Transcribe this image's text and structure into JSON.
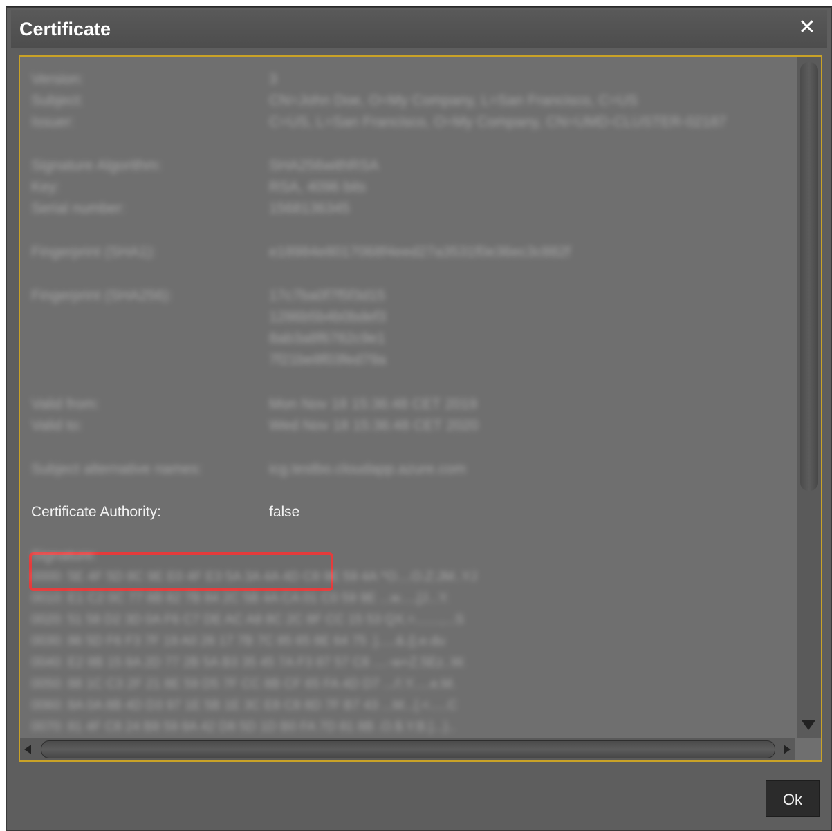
{
  "dialog": {
    "title": "Certificate",
    "close_icon": "close-icon",
    "ok_label": "Ok"
  },
  "certificate": {
    "rows": [
      {
        "label": "Version:",
        "value": "3"
      },
      {
        "label": "Subject:",
        "value": "CN=John Doe, O=My Company, L=San Francisco, C=US"
      },
      {
        "label": "Issuer:",
        "value": "C=US, L=San Francisco, O=My Company, CN=UMD-CLUSTER-02187"
      },
      {
        "label": "Signature Algorithm:",
        "value": "SHA256withRSA"
      },
      {
        "label": "Key:",
        "value": "RSA, 4096 bits"
      },
      {
        "label": "Serial number:",
        "value": "1568136345"
      },
      {
        "label": "Fingerprint (SHA1):",
        "value": "e18984e8017068f4eed27a3531f0e36ec3c882f"
      },
      {
        "label": "Fingerprint (SHA256):",
        "value": "17c7ba0f7f5f3d15"
      },
      {
        "label": "",
        "value": "1286b5b4b0bdef3"
      },
      {
        "label": "",
        "value": "8ab3a8f6782c9e1"
      },
      {
        "label": "",
        "value": "7f21be8f03fed79a"
      },
      {
        "label": "Valid from:",
        "value": "Mon Nov 18 15:36:48 CET 2019"
      },
      {
        "label": "Valid to:",
        "value": "Wed Nov 18 15:36:48 CET 2020"
      },
      {
        "label": "Subject alternative names:",
        "value": "icg.testbo.cloudapp.azure.com"
      },
      {
        "label": "Certificate Authority:",
        "value": "false"
      },
      {
        "label": "Signature:",
        "value": ""
      }
    ],
    "signature_lines": [
      "0000: 5E 4F 5D 8C 9E E0 4F E3   5A 3A 4A 4D C8 9E 59 4A  ^O....O.Z:JM..YJ",
      "0010: E1 C2 0C 77 8B 82 7B 84   2C 5B 4A CA 01 C0 59 9E  ...w....,[J...Y.",
      "0020: 51 58 D2 3D 0A F6 C7 DE   AC A8 8C 2C 8F CC 15 53  QX.=.......,...S",
      "0030: 86 5D F6 F3 7F 19 A0 26   17 7B 7C 85 65 8E 64 75  .].....&.{|.e.du",
      "0040: E2 8B 15 8A 2D 77 2B 5A   B3 35 45 7A F3 87 57 C8  ....-w+Z.5Ez..W.",
      "0050: 88 1C C3 2F 21 8E 59 D5   7F CC 8B CF 65 FA 4D D7  .../!.Y.....e.M.",
      "0060: 8A 0A 8B 4D D3 97 1E 5B   1E 3C E8 C8 8D 7F B7 43  ...M...[.<.....C",
      "0070: 81 4F C8 24 B8 59 8A 42   D8 5D 1D B0 FA 7D 81 8B  .O.$.Y.B.]...}.."
    ]
  },
  "colors": {
    "dialog_bg": "#5e5e5e",
    "content_bg": "#6f6f6f",
    "frame_border": "#c9a227",
    "highlight_border": "#e53b3b"
  },
  "icons": {
    "scroll_up": "arrow-up-icon",
    "scroll_down": "arrow-down-icon",
    "scroll_left": "arrow-left-icon",
    "scroll_right": "arrow-right-icon"
  }
}
